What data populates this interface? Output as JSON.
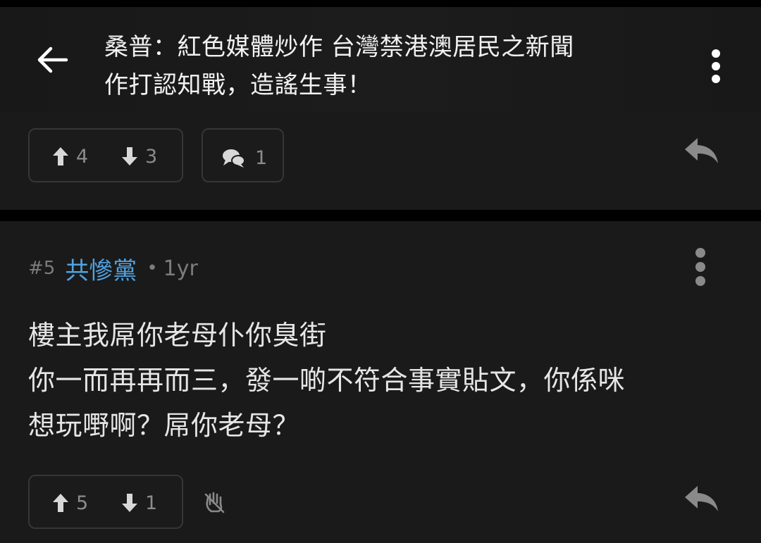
{
  "header": {
    "title_line1": "桑普：紅色媒體炒作 台灣禁港澳居民之新聞",
    "title_line2": "作打認知戰，造謠生事！"
  },
  "post": {
    "upvotes": "4",
    "downvotes": "3",
    "comments": "1"
  },
  "comment": {
    "number": "#5",
    "author": "共慘黨",
    "separator": "•",
    "age": "1yr",
    "lines": [
      "樓主我屌你老母仆你臭街",
      "你一而再再而三，發一啲不符合事實貼文，你係咪",
      "想玩嘢啊？屌你老母？"
    ],
    "upvotes": "5",
    "downvotes": "1"
  },
  "colors": {
    "background": "#1a1a1a",
    "author": "#4fa3e3",
    "muted": "#8c8c8c",
    "text": "#e6e6e6"
  },
  "icons": [
    "back-arrow-icon",
    "kebab-menu-icon",
    "arrow-up-icon",
    "arrow-down-icon",
    "comment-bubble-icon",
    "reply-icon",
    "clap-icon"
  ]
}
